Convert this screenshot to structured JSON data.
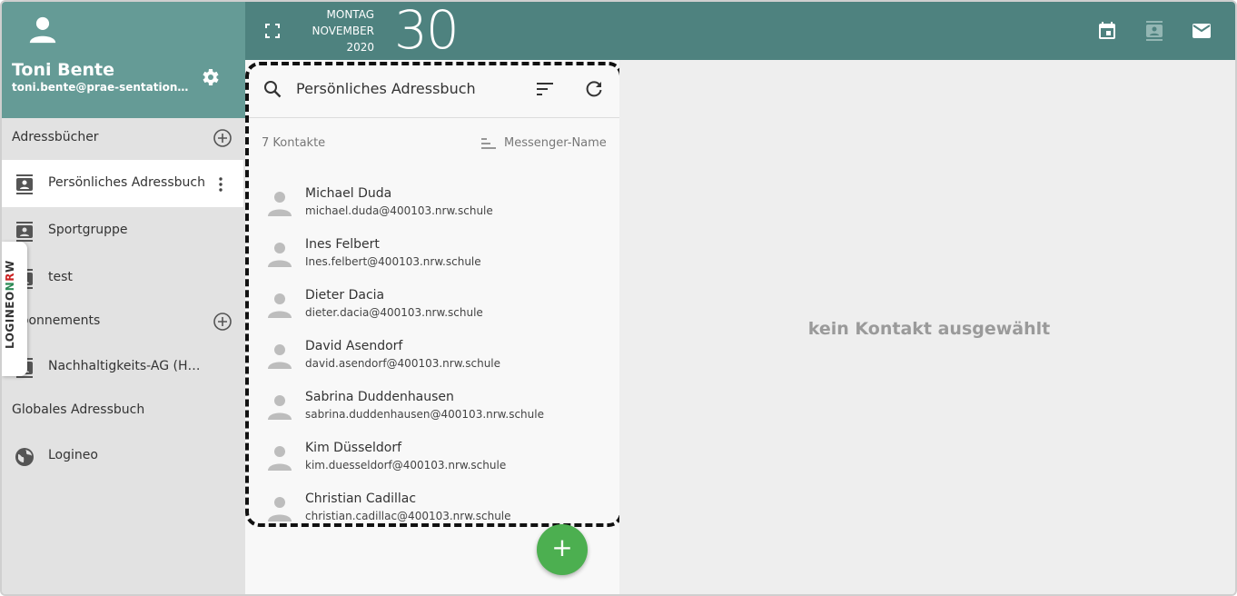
{
  "user": {
    "name": "Toni Bente",
    "email": "toni.bente@prae-sentation.nrw.schule",
    "icons": {
      "avatar": "person-icon",
      "settings": "gear-icon"
    }
  },
  "sidebar": {
    "sections": [
      {
        "label": "Adressbücher",
        "add_icon": "add-circle-icon"
      },
      {
        "label": "Abonnements",
        "add_icon": "add-circle-icon"
      },
      {
        "label": "Globales Adressbuch"
      }
    ],
    "items": [
      {
        "label": "Persönliches Adressbuch",
        "icon": "contact-book-icon",
        "active": true
      },
      {
        "label": "Sportgruppe",
        "icon": "contact-book-icon"
      },
      {
        "label": "test",
        "icon": "contact-book-icon"
      },
      {
        "label": "Nachhaltigkeits-AG (Heinrich)",
        "icon": "contact-book-icon"
      },
      {
        "label": "Logineo",
        "icon": "globe-icon"
      }
    ]
  },
  "badge": {
    "part1": "LOGINEO",
    "part2": "N",
    "part3": "R",
    "part4": "W"
  },
  "topbar": {
    "weekday": "MONTAG",
    "month": "NOVEMBER",
    "year": "2020",
    "day": "30",
    "icons": [
      "fullscreen-icon",
      "calendar-icon",
      "contacts-icon",
      "mail-icon"
    ]
  },
  "contact_list": {
    "title": "Persönliches Adressbuch",
    "count": "7 Kontakte",
    "sort_mode": "Messenger-Name",
    "contacts": [
      {
        "name": "Michael Duda",
        "email": "michael.duda@400103.nrw.schule"
      },
      {
        "name": "Ines Felbert",
        "email": "Ines.felbert@400103.nrw.schule"
      },
      {
        "name": "Dieter Dacia",
        "email": "dieter.dacia@400103.nrw.schule"
      },
      {
        "name": "David Asendorf",
        "email": "david.asendorf@400103.nrw.schule"
      },
      {
        "name": "Sabrina Duddenhausen",
        "email": "sabrina.duddenhausen@400103.nrw.schule"
      },
      {
        "name": "Kim Düsseldorf",
        "email": "kim.duesseldorf@400103.nrw.schule"
      },
      {
        "name": "Christian Cadillac",
        "email": "christian.cadillac@400103.nrw.schule"
      }
    ]
  },
  "fab": {
    "label": "+"
  },
  "detail": {
    "empty_message": "kein Kontakt ausgewählt"
  },
  "colors": {
    "header": "#659b96",
    "topbar": "#4e827f",
    "fab": "#4caf50"
  }
}
